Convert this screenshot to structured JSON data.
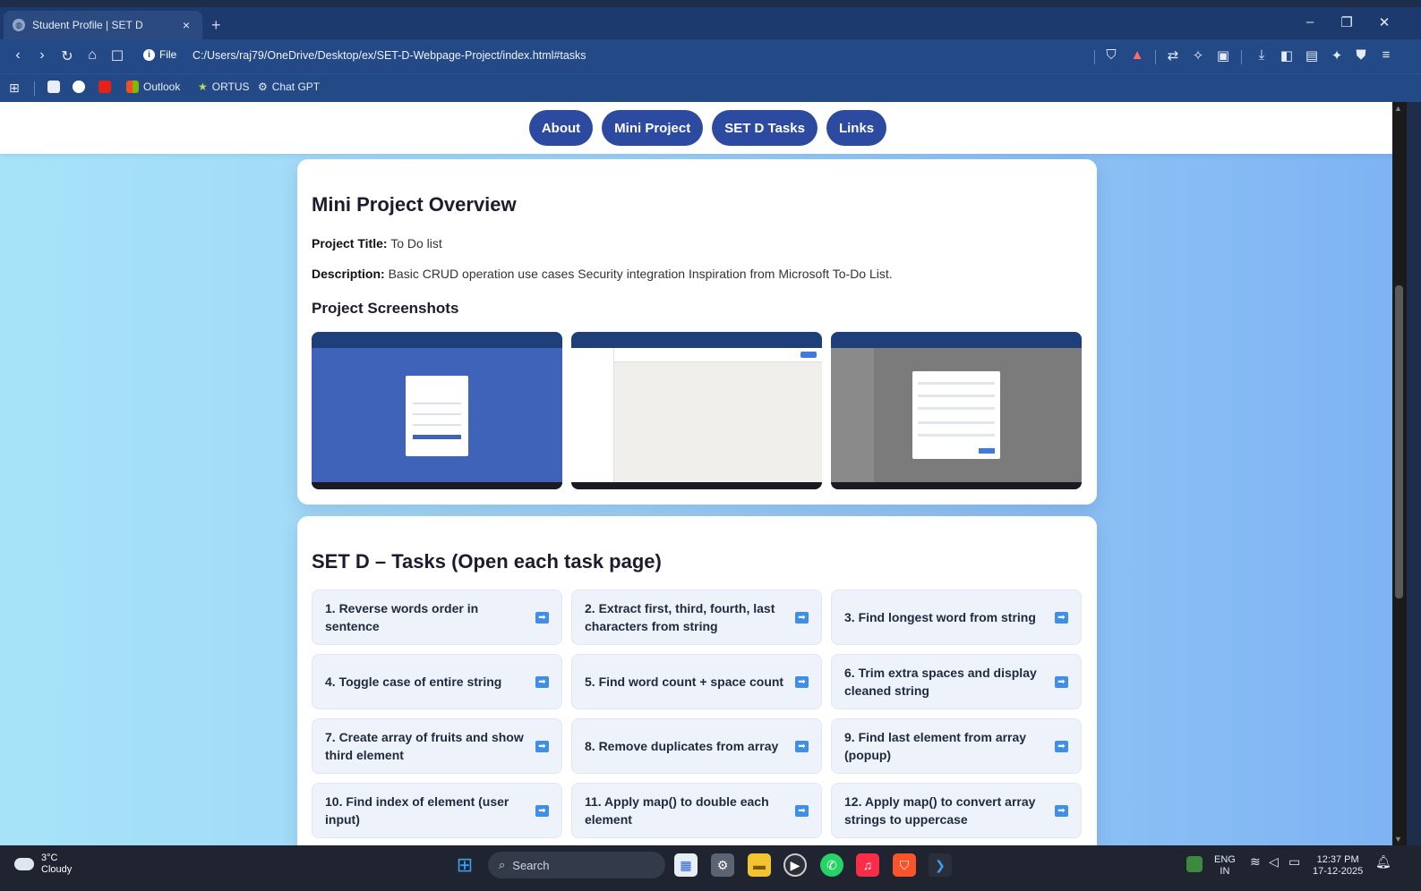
{
  "browser": {
    "tab_title": "Student Profile | SET D",
    "tab_close": "×",
    "new_tab": "+",
    "win_min": "–",
    "win_restore": "❐",
    "win_close": "✕",
    "file_label": "File",
    "url": "C:/Users/raj79/OneDrive/Desktop/ex/SET-D-Webpage-Project/index.html#tasks",
    "bookmarks": [
      "Outlook",
      "ORTUS",
      "Chat GPT"
    ]
  },
  "nav": {
    "items": [
      "About",
      "Mini Project",
      "SET D Tasks",
      "Links"
    ]
  },
  "mini_project": {
    "heading": "Mini Project Overview",
    "title_label": "Project Title:",
    "title_value": "To Do list",
    "desc_label": "Description:",
    "desc_value": "Basic CRUD operation use cases Security integration Inspiration from Microsoft To-Do List.",
    "screenshots_heading": "Project Screenshots"
  },
  "tasks": {
    "heading": "SET D – Tasks (Open each task page)",
    "items": [
      "1. Reverse words order in sentence",
      "2. Extract first, third, fourth, last characters from string",
      "3. Find longest word from string",
      "4. Toggle case of entire string",
      "5. Find word count + space count",
      "6. Trim extra spaces and display cleaned string",
      "7. Create array of fruits and show third element",
      "8. Remove duplicates from array",
      "9. Find last element from array (popup)",
      "10. Find index of element (user input)",
      "11. Apply map() to double each element",
      "12. Apply map() to convert array strings to uppercase"
    ]
  },
  "taskbar": {
    "temp": "3°C",
    "weather": "Cloudy",
    "search": "Search",
    "lang1": "ENG",
    "lang2": "IN",
    "time": "12:37 PM",
    "date": "17-12-2025"
  },
  "colors": {
    "accent": "#2b4aa0",
    "task_icon": "#3f8ee8"
  }
}
